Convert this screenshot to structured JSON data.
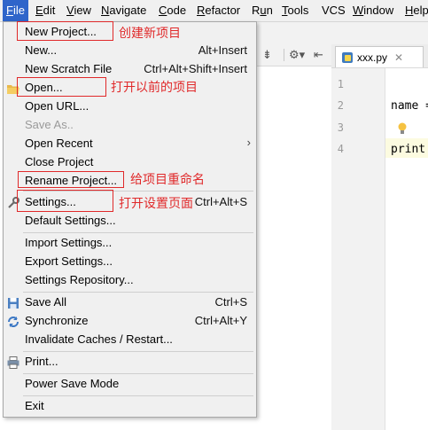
{
  "menubar": {
    "items": [
      {
        "label": "File",
        "mnemonic": "F",
        "rest": "ile",
        "active": true
      },
      {
        "label": "Edit",
        "mnemonic": "E",
        "rest": "dit"
      },
      {
        "label": "View",
        "mnemonic": "V",
        "rest": "iew"
      },
      {
        "label": "Navigate",
        "mnemonic": "N",
        "rest": "avigate"
      },
      {
        "label": "Code",
        "mnemonic": "C",
        "rest": "ode"
      },
      {
        "label": "Refactor",
        "mnemonic": "R",
        "rest": "efactor"
      },
      {
        "label": "Run",
        "mnemonic": "",
        "pre": "R",
        "mid": "u",
        "post": "n"
      },
      {
        "label": "Tools",
        "mnemonic": "T",
        "rest": "ools"
      },
      {
        "label": "VCS",
        "mnemonic": "",
        "rest": "VCS"
      },
      {
        "label": "Window",
        "mnemonic": "W",
        "rest": "indow"
      },
      {
        "label": "Help",
        "mnemonic": "H",
        "rest": "elp"
      }
    ]
  },
  "file_menu": {
    "new_project": "New Project...",
    "new": "New...",
    "new_shortcut": "Alt+Insert",
    "new_scratch": "New Scratch File",
    "new_scratch_shortcut": "Ctrl+Alt+Shift+Insert",
    "open": "Open...",
    "open_url": "Open URL...",
    "save_as": "Save As..",
    "open_recent": "Open Recent",
    "close_project": "Close Project",
    "rename_project": "Rename Project...",
    "settings": "Settings...",
    "settings_shortcut": "Ctrl+Alt+S",
    "default_settings": "Default Settings...",
    "import_settings": "Import Settings...",
    "export_settings": "Export Settings...",
    "settings_repository": "Settings Repository...",
    "save_all": "Save All",
    "save_all_shortcut": "Ctrl+S",
    "synchronize": "Synchronize",
    "synchronize_shortcut": "Ctrl+Alt+Y",
    "invalidate_caches": "Invalidate Caches / Restart...",
    "print": "Print...",
    "power_save_mode": "Power Save Mode",
    "exit": "Exit"
  },
  "annotations": {
    "new_project": "创建新项目",
    "open": "打开以前的项目",
    "rename_project": "给项目重命名",
    "settings": "打开设置页面"
  },
  "editor": {
    "tab_name": "xxx.py",
    "line_numbers": [
      "1",
      "2",
      "3",
      "4"
    ],
    "line2": "name =",
    "line4": "print"
  },
  "colors": {
    "annotation_red": "#e0292a",
    "menu_highlight": "#2f65ca"
  }
}
